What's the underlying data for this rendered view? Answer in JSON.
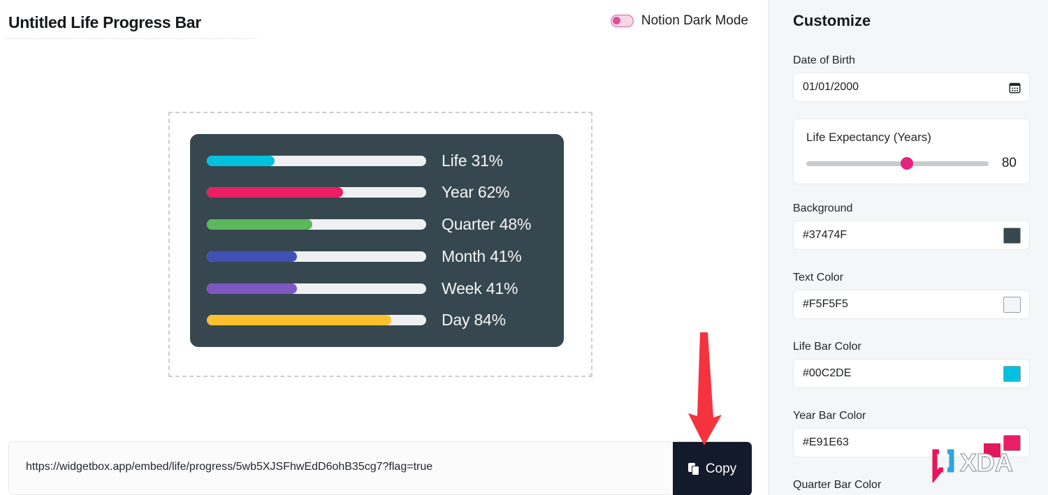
{
  "header": {
    "title": "Untitled Life Progress Bar",
    "dark_mode_label": "Notion Dark Mode",
    "dark_mode_on": false
  },
  "widget": {
    "background_color": "#37474F",
    "text_color": "#F5F5F5",
    "track_color": "#EFF0F1",
    "rows": [
      {
        "name": "Life",
        "label": "Life 31%",
        "percent": 31,
        "color": "#00C2DE"
      },
      {
        "name": "Year",
        "label": "Year 62%",
        "percent": 62,
        "color": "#E91E63"
      },
      {
        "name": "Quarter",
        "label": "Quarter 48%",
        "percent": 48,
        "color": "#5CB85C"
      },
      {
        "name": "Month",
        "label": "Month 41%",
        "percent": 41,
        "color": "#3F51B5"
      },
      {
        "name": "Week",
        "label": "Week 41%",
        "percent": 41,
        "color": "#7E57C2"
      },
      {
        "name": "Day",
        "label": "Day 84%",
        "percent": 84,
        "color": "#FBC02D"
      }
    ]
  },
  "embed": {
    "url": "https://widgetbox.app/embed/life/progress/5wb5XJSFhwEdD6ohB35cg7?flag=true",
    "copy_label": "Copy",
    "copy_icon": "copy-icon"
  },
  "annotation": {
    "arrow_color": "#F5333F",
    "points_to": "copy-button"
  },
  "sidebar": {
    "title": "Customize",
    "date_of_birth": {
      "label": "Date of Birth",
      "value": "01/01/2000",
      "icon": "calendar-icon"
    },
    "life_expectancy": {
      "label": "Life Expectancy (Years)",
      "value": "80",
      "min": 0,
      "max": 120,
      "knob_percent": 55,
      "knob_color": "#E3247F",
      "track_color": "#C9CCCF"
    },
    "color_fields": [
      {
        "label": "Background",
        "value": "#37474F",
        "swatch": "#37474F"
      },
      {
        "label": "Text Color",
        "value": "#F5F5F5",
        "swatch": "#F5F5F5"
      },
      {
        "label": "Life Bar Color",
        "value": "#00C2DE",
        "swatch": "#00C2DE"
      },
      {
        "label": "Year Bar Color",
        "value": "#E91E63",
        "swatch": "#E91E63"
      }
    ],
    "next_field_label": "Quarter Bar Color"
  },
  "watermark": {
    "text": "XDA",
    "accent_pink": "#E5175C",
    "accent_blue": "#2EA4E0"
  }
}
